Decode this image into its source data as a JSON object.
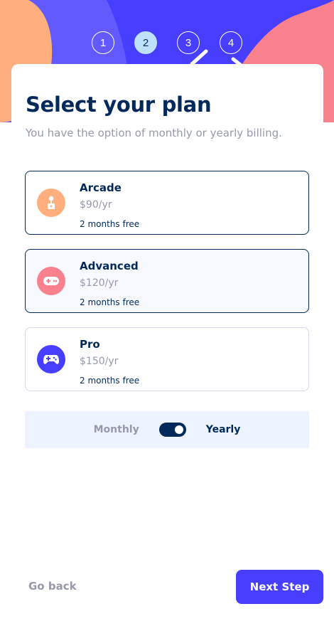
{
  "steps": [
    "1",
    "2",
    "3",
    "4"
  ],
  "active_step": 2,
  "header": {
    "title": "Select your plan",
    "subtitle": "You have the option of monthly or yearly billing."
  },
  "plans": [
    {
      "name": "Arcade",
      "price": "$90/yr",
      "promo": "2 months free",
      "icon": "arcade-joystick-icon",
      "color": "#ffaf7e"
    },
    {
      "name": "Advanced",
      "price": "$120/yr",
      "promo": "2 months free",
      "icon": "gamepad-icon",
      "color": "#f9818e"
    },
    {
      "name": "Pro",
      "price": "$150/yr",
      "promo": "2 months free",
      "icon": "controller-icon",
      "color": "#483eff"
    }
  ],
  "billing": {
    "monthly_label": "Monthly",
    "yearly_label": "Yearly",
    "selected": "Yearly"
  },
  "footer": {
    "back_label": "Go back",
    "next_label": "Next Step"
  },
  "colors": {
    "primary": "#483eff",
    "marine": "#02295a",
    "gray": "#9699ab",
    "accent": "#bee2fd"
  }
}
